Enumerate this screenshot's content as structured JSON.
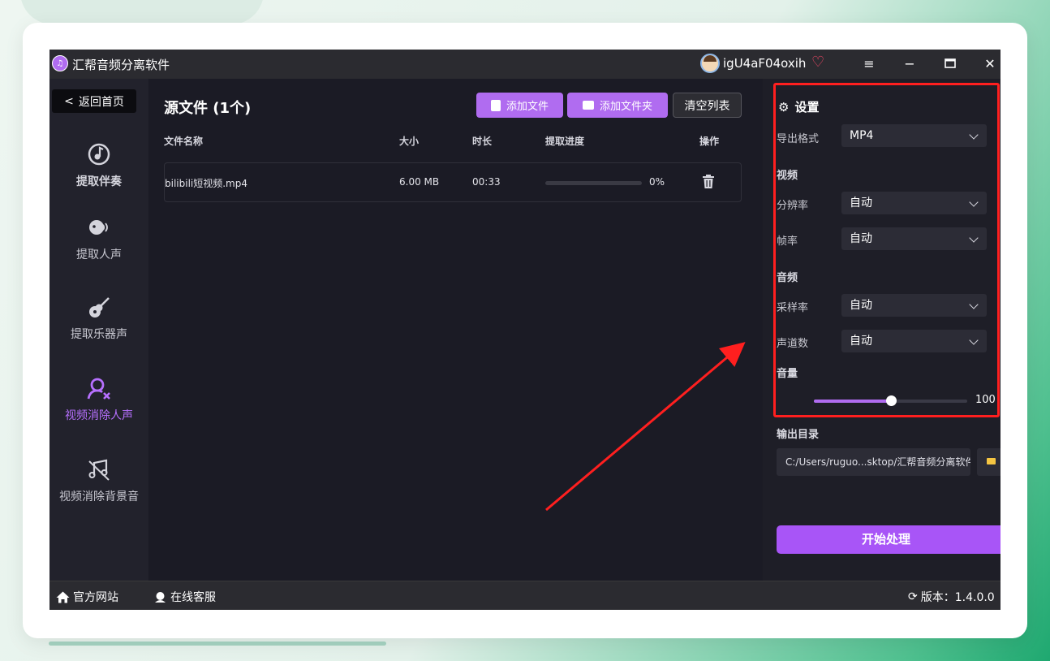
{
  "app": {
    "title": "汇帮音频分离软件",
    "username": "igU4aF04oxih"
  },
  "sidebar": {
    "back_label": "返回首页",
    "items": [
      {
        "label": "提取伴奏",
        "icon": "music-note-disc-icon"
      },
      {
        "label": "提取人声",
        "icon": "voice-head-icon"
      },
      {
        "label": "提取乐器声",
        "icon": "guitar-icon"
      },
      {
        "label": "视频消除人声",
        "icon": "person-remove-icon"
      },
      {
        "label": "视频消除背景音",
        "icon": "music-off-icon"
      }
    ],
    "active_index": 3
  },
  "main": {
    "title": "源文件 (1个)",
    "add_file_label": "添加文件",
    "add_folder_label": "添加文件夹",
    "clear_label": "清空列表",
    "columns": [
      "文件名称",
      "大小",
      "时长",
      "提取进度",
      "操作"
    ],
    "rows": [
      {
        "name": "bilibili短视频.mp4",
        "size": "6.00 MB",
        "duration": "00:33",
        "progress": 0,
        "progress_text": "0%"
      }
    ]
  },
  "settings": {
    "title": "设置",
    "format_label": "导出格式",
    "format_value": "MP4",
    "video_group": "视频",
    "resolution_label": "分辨率",
    "resolution_value": "自动",
    "framerate_label": "帧率",
    "framerate_value": "自动",
    "audio_group": "音频",
    "samplerate_label": "采样率",
    "samplerate_value": "自动",
    "channels_label": "声道数",
    "channels_value": "自动",
    "volume_label": "音量",
    "volume_value": "100",
    "volume_fraction": 0.5,
    "output_label": "输出目录",
    "output_path": "C:/Users/ruguo...sktop/汇帮音频分离软件",
    "start_label": "开始处理"
  },
  "footer": {
    "website_label": "官方网站",
    "support_label": "在线客服",
    "version_label": "版本：1.4.0.0"
  },
  "colors": {
    "accent": "#b06cf0",
    "start_button": "#a855f7",
    "highlight_box": "#ff1f1f"
  }
}
